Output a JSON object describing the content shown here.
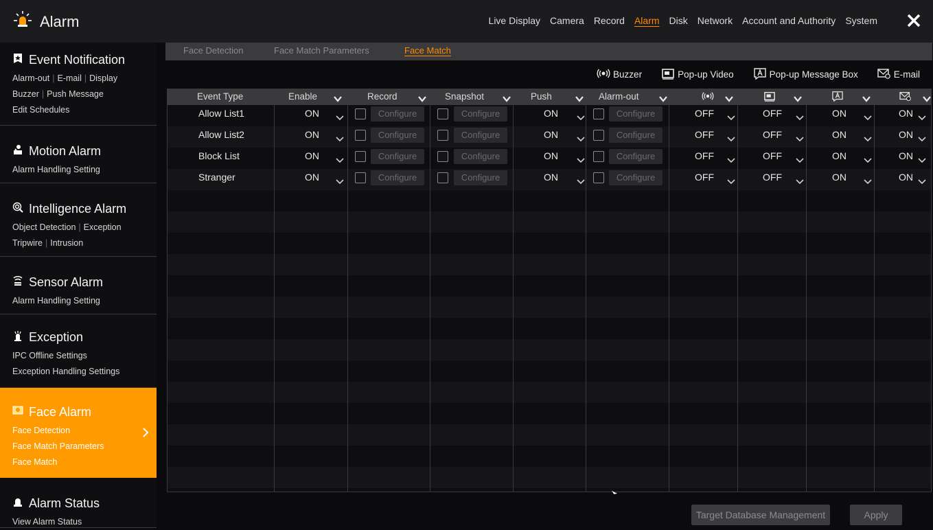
{
  "app": {
    "title": "Alarm",
    "icon": "alarm-siren-icon"
  },
  "top_nav": {
    "items": [
      "Live Display",
      "Camera",
      "Record",
      "Alarm",
      "Disk",
      "Network",
      "Account and Authority",
      "System"
    ],
    "active": "Alarm",
    "close_icon": "close-icon"
  },
  "sidebar": {
    "sections": [
      {
        "title": "Event Notification",
        "icon": "star-flag-icon",
        "links": [
          [
            "Alarm-out",
            "E-mail",
            "Display"
          ],
          [
            "Buzzer",
            "Push Message"
          ],
          [
            "Edit Schedules"
          ]
        ]
      },
      {
        "title": "Motion Alarm",
        "icon": "motion-icon",
        "links": [
          [
            "Alarm Handling Setting"
          ]
        ]
      },
      {
        "title": "Intelligence Alarm",
        "icon": "intelligence-icon",
        "links": [
          [
            "Object Detection",
            "Exception"
          ],
          [
            "Tripwire",
            "Intrusion"
          ]
        ]
      },
      {
        "title": "Sensor Alarm",
        "icon": "sensor-icon",
        "links": [
          [
            "Alarm Handling Setting"
          ]
        ]
      },
      {
        "title": "Exception",
        "icon": "exception-icon",
        "links": [
          [
            "IPC Offline Settings"
          ],
          [
            "Exception Handling Settings"
          ]
        ]
      },
      {
        "title": "Face Alarm",
        "icon": "face-icon",
        "links": [
          [
            "Face Detection"
          ],
          [
            "Face Match Parameters"
          ],
          [
            "Face Match"
          ]
        ],
        "active": true
      },
      {
        "title": "Alarm Status",
        "icon": "alarm-status-icon",
        "links": [
          [
            "View Alarm Status"
          ]
        ]
      }
    ]
  },
  "sub_tabs": {
    "items": [
      "Face Detection",
      "Face Match Parameters",
      "Face Match"
    ],
    "active": "Face Match"
  },
  "legend": [
    {
      "icon": "buzzer-icon",
      "label": "Buzzer"
    },
    {
      "icon": "popup-video-icon",
      "label": "Pop-up Video"
    },
    {
      "icon": "popup-message-icon",
      "label": "Pop-up Message Box"
    },
    {
      "icon": "email-icon",
      "label": "E-mail"
    }
  ],
  "table": {
    "headers": [
      "Event Type",
      "Enable",
      "Record",
      "Snapshot",
      "Push",
      "Alarm-out"
    ],
    "icon_headers": [
      "buzzer-icon",
      "popup-video-icon",
      "popup-message-icon",
      "email-icon"
    ],
    "configure_label": "Configure",
    "rows": [
      {
        "event": "Allow List1",
        "enable": "ON",
        "push": "ON",
        "buzzer": "OFF",
        "popup_video": "OFF",
        "popup_msg": "ON",
        "email": "ON"
      },
      {
        "event": "Allow List2",
        "enable": "ON",
        "push": "ON",
        "buzzer": "OFF",
        "popup_video": "OFF",
        "popup_msg": "ON",
        "email": "ON"
      },
      {
        "event": "Block List",
        "enable": "ON",
        "push": "ON",
        "buzzer": "OFF",
        "popup_video": "OFF",
        "popup_msg": "ON",
        "email": "ON"
      },
      {
        "event": "Stranger",
        "enable": "ON",
        "push": "ON",
        "buzzer": "OFF",
        "popup_video": "OFF",
        "popup_msg": "ON",
        "email": "ON"
      }
    ]
  },
  "buttons": {
    "target_db": "Target Database Management",
    "apply": "Apply"
  },
  "colors": {
    "accent": "#ff9a00",
    "background": "#0b0b0d",
    "header": "#3a3a3d"
  }
}
